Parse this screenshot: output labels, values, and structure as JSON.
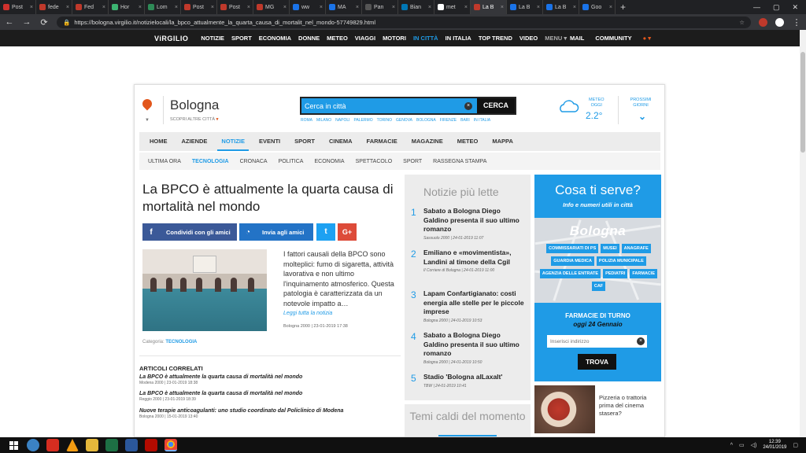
{
  "browser": {
    "tabs": [
      "Post",
      "fede",
      "Fed",
      "Hor",
      "Lom",
      "Post",
      "Post",
      "MG",
      "ww",
      "MA",
      "Pan",
      "Bian",
      "met",
      "La B",
      "La B",
      "La B",
      "Goo"
    ],
    "active_tab": 13,
    "url": "https://bologna.virgilio.it/notizielocali/la_bpco_attualmente_la_quarta_causa_di_mortalit_nel_mondo-57749829.html"
  },
  "sitenav": {
    "logo": "ViRGILIO",
    "items": [
      "NOTIZIE",
      "SPORT",
      "ECONOMIA",
      "DONNE",
      "METEO",
      "VIAGGI",
      "MOTORI",
      "IN CITTÀ",
      "IN ITALIA",
      "TOP TREND",
      "VIDEO",
      "MENU ▾"
    ],
    "active": "IN CITTÀ",
    "right": [
      "MAIL",
      "COMMUNITY"
    ]
  },
  "city": {
    "name": "Bologna",
    "scopri": "SCOPRI ALTRE CITTÀ",
    "search_placeholder": "Cerca in città",
    "search_button": "CERCA",
    "quick_cities": [
      "ROMA",
      "MILANO",
      "NAPOLI",
      "PALERMO",
      "TORINO",
      "GENOVA",
      "BOLOGNA",
      "FIRENZE",
      "BARI",
      "IN ITALIA"
    ]
  },
  "meteo": {
    "label1": "METEO",
    "label2": "OGGI",
    "temp": "2.2°",
    "next1": "PROSSIMI",
    "next2": "GIORNI",
    "icon": "cloud-icon"
  },
  "mainnav": [
    "HOME",
    "AZIENDE",
    "NOTIZIE",
    "EVENTI",
    "SPORT",
    "CINEMA",
    "FARMACIE",
    "MAGAZINE",
    "METEO",
    "MAPPA"
  ],
  "mainnav_active": "NOTIZIE",
  "subnav": [
    "ULTIMA ORA",
    "TECNOLOGIA",
    "CRONACA",
    "POLITICA",
    "ECONOMIA",
    "SPETTACOLO",
    "SPORT",
    "RASSEGNA STAMPA"
  ],
  "subnav_active": "TECNOLOGIA",
  "article": {
    "title": "La BPCO è attualmente la quarta causa di mortalità nel mondo",
    "share_facebook": "Condividi con gli amici",
    "share_messenger": "Invia agli amici",
    "excerpt": "I fattori causali della BPCO sono molteplici: fumo di sigaretta, attività lavorativa e non ultimo l'inquinamento atmosferico. Questa patologia è caratterizzata da un notevole impatto a…",
    "read_more": "Leggi tutta la notizia",
    "meta": "Bologna 2000 | 23-01-2019 17:38",
    "category_label": "Categoria:",
    "category": "TECNOLOGIA"
  },
  "related": {
    "heading": "ARTICOLI CORRELATI",
    "items": [
      {
        "title": "La BPCO è attualmente la quarta causa di mortalità nel mondo",
        "meta": "Modena 2000 | 23-01-2019 18:38"
      },
      {
        "title": "La BPCO è attualmente la quarta causa di mortalità nel mondo",
        "meta": "Reggio 2000 | 23-01-2019 18:39"
      },
      {
        "title": "Nuove terapie anticoagulanti: uno studio coordinato dal Policlinico di Modena",
        "meta": "Bologna 2000 | 15-01-2019 13:40"
      }
    ]
  },
  "most_read": {
    "heading": "Notizie più lette",
    "items": [
      {
        "n": "1",
        "title": "Sabato a Bologna Diego Galdino presenta il suo ultimo romanzo",
        "meta": "Sassuolo 2000 | 24-01-2019 11:07"
      },
      {
        "n": "2",
        "title": "Emiliano e «movimentista», Landini al timone della Cgil",
        "meta": "Il Corriere di Bologna | 24-01-2019 11:00"
      },
      {
        "n": "3",
        "title": "Lapam Confartigianato: costi energia alle stelle per le piccole imprese",
        "meta": "Bologna 2000 | 24-01-2019 10:53"
      },
      {
        "n": "4",
        "title": "Sabato a Bologna Diego Galdino presenta il suo ultimo romanzo",
        "meta": "Bologna 2000 | 24-01-2019 10:50"
      },
      {
        "n": "5",
        "title": "Stadio 'Bologna alLaxalt'",
        "meta": "TBW | 24-01-2019 10:41"
      }
    ],
    "temi": "Temi caldi del momento"
  },
  "services": {
    "heading": "Cosa ti serve?",
    "sub": "Info e numeri utili in città",
    "map_city": "Bologna",
    "chips": [
      "COMMISSARIATI DI PS",
      "MUSEI",
      "ANAGRAFE",
      "GUARDIA MEDICA",
      "POLIZIA MUNICIPALE",
      "AGENZIA DELLE ENTRATE",
      "PEDIATRI",
      "FARMACIE",
      "CAF"
    ],
    "farmacie_heading": "FARMACIE DI TURNO",
    "farmacie_date": "oggi 24 Gennaio",
    "farmacie_placeholder": "Inserisci indirizzo",
    "farmacie_button": "TROVA"
  },
  "promo": {
    "text": "Pizzeria o trattoria prima del cinema stasera?"
  },
  "taskbar": {
    "time": "12:39",
    "date": "24/01/2019"
  }
}
